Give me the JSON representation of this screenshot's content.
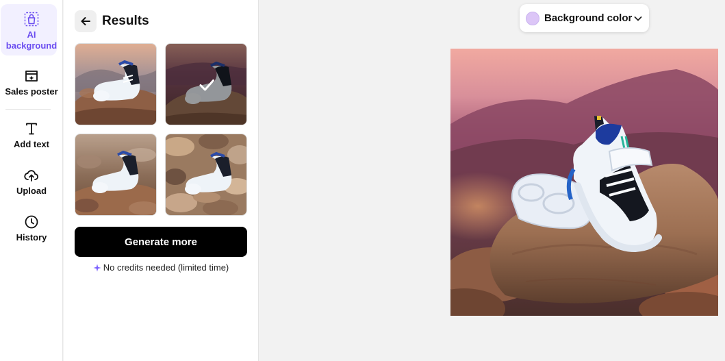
{
  "sidebar": {
    "items": [
      {
        "label": "AI background",
        "icon": "ai-background-icon",
        "active": true
      },
      {
        "label": "Sales poster",
        "icon": "sales-poster-icon",
        "active": false
      },
      {
        "label": "Add text",
        "icon": "text-icon",
        "active": false
      },
      {
        "label": "Upload",
        "icon": "upload-cloud-icon",
        "active": false
      },
      {
        "label": "History",
        "icon": "clock-icon",
        "active": false
      }
    ]
  },
  "results": {
    "title": "Results",
    "selected_index": 1,
    "generate_label": "Generate more",
    "credits_note": "No credits needed (limited time)"
  },
  "toolbar": {
    "background_color_label": "Background color",
    "swatch_color": "#dcc6f7"
  },
  "colors": {
    "accent": "#6a4cf0",
    "sparkle": "#7b61ff",
    "button_bg": "#000000"
  }
}
